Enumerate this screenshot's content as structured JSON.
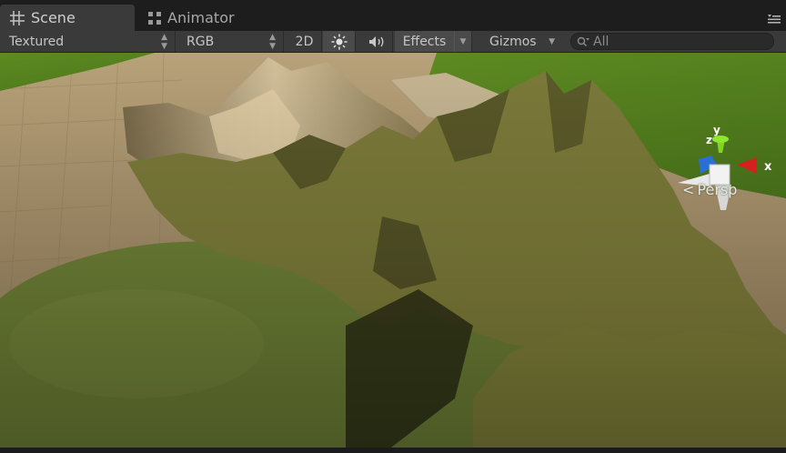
{
  "tabs": [
    {
      "label": "Scene",
      "icon": "scene-grid-icon",
      "active": true
    },
    {
      "label": "Animator",
      "icon": "animator-icon",
      "active": false
    }
  ],
  "toolbar": {
    "draw_mode": "Textured",
    "render_mode": "RGB",
    "toggle_2d": "2D",
    "lighting_icon": "sun-icon",
    "audio_icon": "speaker-icon",
    "effects_label": "Effects",
    "gizmos_label": "Gizmos",
    "search_placeholder": "All"
  },
  "scene": {
    "projection_label": "Persp",
    "gizmo_axes": {
      "x": "x",
      "y": "y",
      "z": "z"
    },
    "colors": {
      "grass": "#6a8a2a",
      "sand": "#b49d74",
      "terrain": "#8d8b3c",
      "x_axis": "#d62020",
      "y_axis": "#7fd620",
      "z_axis": "#2a6fd6"
    }
  }
}
